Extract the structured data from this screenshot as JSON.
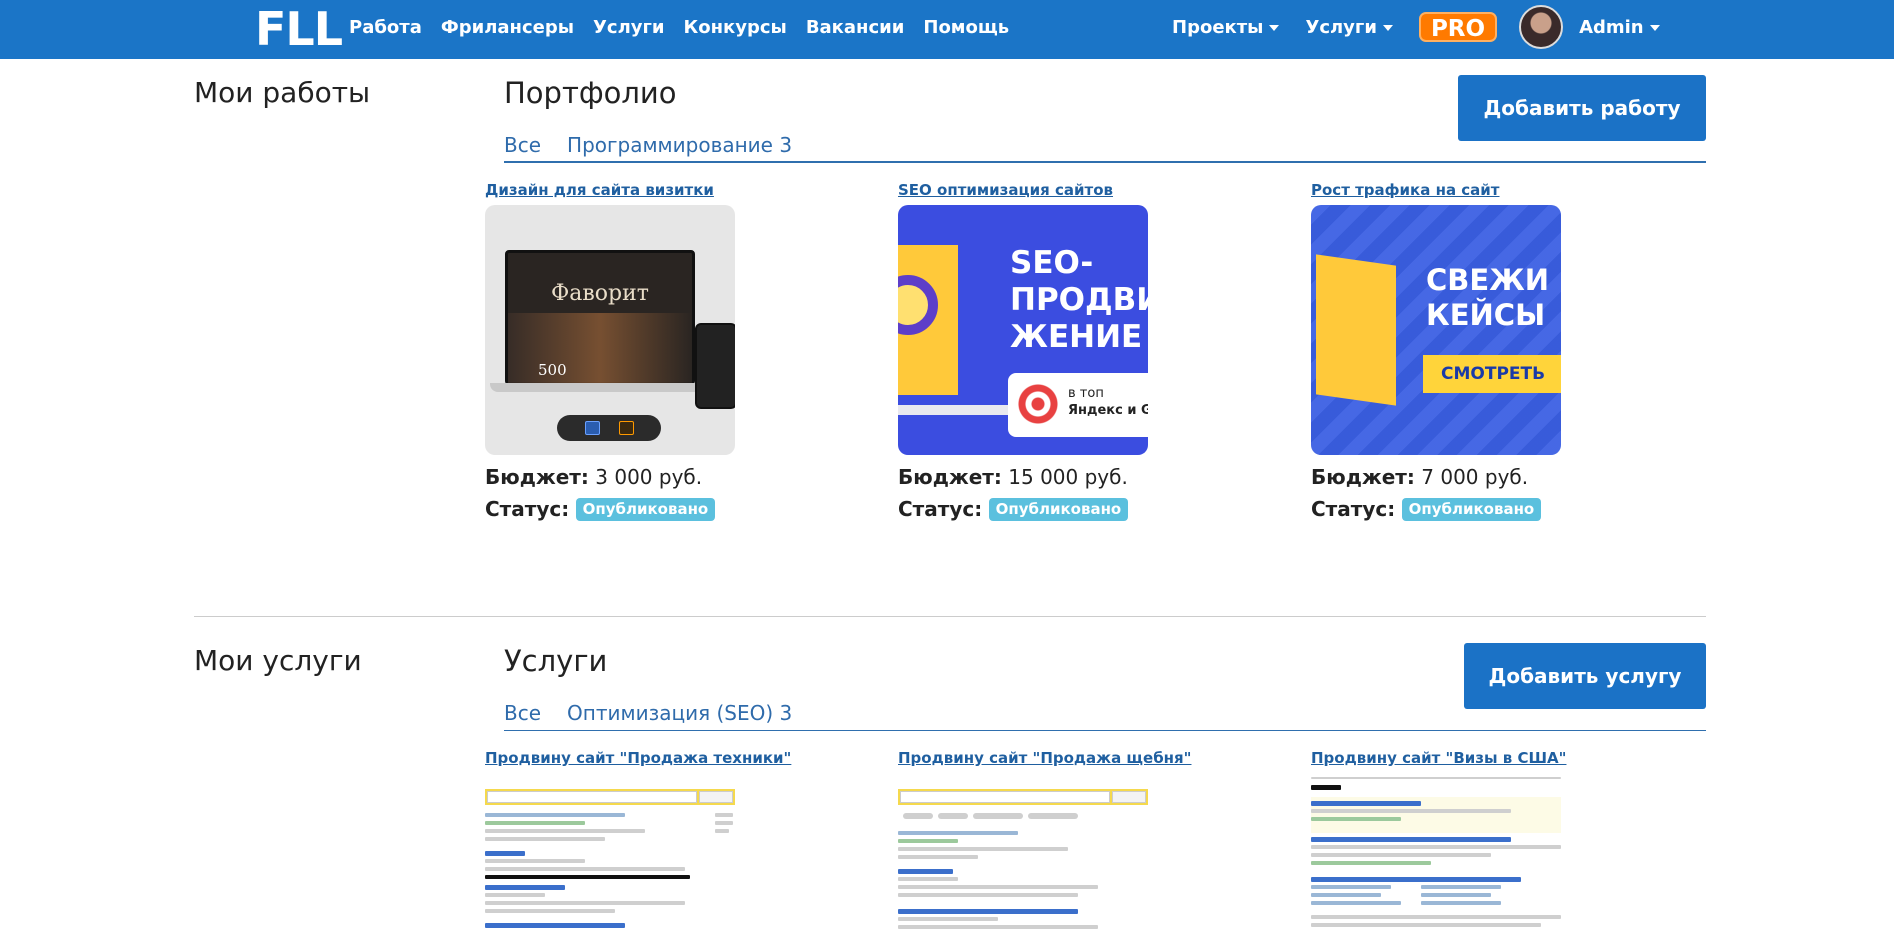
{
  "navbar": {
    "logo": "FLL",
    "links": [
      "Работа",
      "Фрилансеры",
      "Услуги",
      "Конкурсы",
      "Вакансии",
      "Помощь"
    ],
    "dropdowns": [
      "Проекты",
      "Услуги"
    ],
    "pro_label": "PRO",
    "user_name": "Admin"
  },
  "works": {
    "side_title": "Мои работы",
    "title": "Портфолио",
    "add_button": "Добавить работу",
    "tabs": [
      "Все",
      "Программирование 3"
    ],
    "budget_label": "Бюджет:",
    "status_label": "Статус:",
    "items": [
      {
        "title": "Дизайн для сайта визитки",
        "budget": "3 000 руб.",
        "status": "Опубликовано",
        "thumb_text": "Фаворит",
        "thumb_num": "500"
      },
      {
        "title": "SEO оптимизация сайтов",
        "budget": "15 000 руб.",
        "status": "Опубликовано",
        "thumb_text_1": "SEO-",
        "thumb_text_2": "ПРОДВИ",
        "thumb_text_3": "ЖЕНИЕ",
        "thumb_small_1": "в топ",
        "thumb_small_2": "Яндекс и Goo"
      },
      {
        "title": "Рост трафика на сайт",
        "budget": "7 000 руб.",
        "status": "Опубликовано",
        "thumb_text_1": "СВЕЖИ",
        "thumb_text_2": "КЕЙСЫ",
        "thumb_button": "СМОТРЕТЬ"
      }
    ]
  },
  "services": {
    "side_title": "Мои услуги",
    "title": "Услуги",
    "add_button": "Добавить услугу",
    "tabs": [
      "Все",
      "Оптимизация (SEO) 3"
    ],
    "items": [
      {
        "title": "Продвину сайт \"Продажа техники\""
      },
      {
        "title": "Продвину сайт \"Продажа щебня\""
      },
      {
        "title": "Продвину сайт \"Визы в США\""
      }
    ]
  },
  "colors": {
    "navbar": "#1b75c7",
    "primary_button": "#1b72c6",
    "badge": "#5bc0de",
    "pro": "#ff7a00"
  },
  "icons": {
    "caret": "chevron-down-icon",
    "avatar": "user-avatar"
  }
}
